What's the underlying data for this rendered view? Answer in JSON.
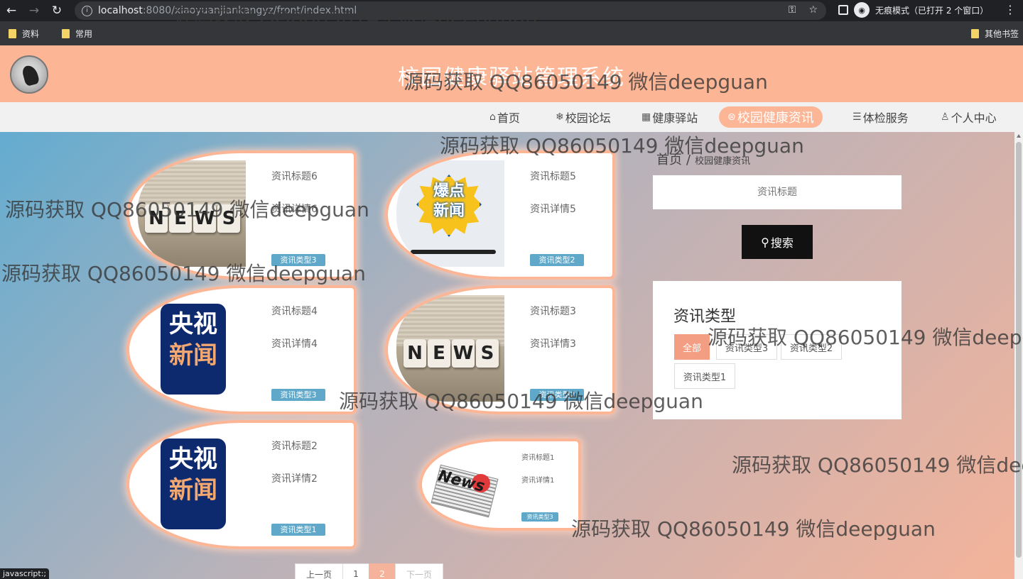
{
  "browser": {
    "url_host": "localhost",
    "url_rest": ":8080/xiaoyuanjiankangyz/front/index.html",
    "incognito_label": "无痕模式（已打开 2 个窗口）",
    "bookmarks": [
      "资料",
      "常用"
    ],
    "other_bookmarks": "其他书签",
    "status_text": "javascript:;"
  },
  "site": {
    "title": "校园健康驿站管理系统"
  },
  "nav": {
    "items": [
      {
        "icon": "⌂",
        "label": "首页"
      },
      {
        "icon": "❄",
        "label": "校园论坛"
      },
      {
        "icon": "▦",
        "label": "健康驿站"
      },
      {
        "icon": "⊜",
        "label": "校园健康资讯"
      },
      {
        "icon": "☰",
        "label": "体检服务"
      },
      {
        "icon": "♙",
        "label": "个人中心"
      }
    ]
  },
  "cards": [
    {
      "title": "资讯标题6",
      "detail": "资讯详情6",
      "type": "资讯类型3"
    },
    {
      "title": "资讯标题5",
      "detail": "资讯详情5",
      "type": "资讯类型2"
    },
    {
      "title": "资讯标题4",
      "detail": "资讯详情4",
      "type": "资讯类型3"
    },
    {
      "title": "资讯标题3",
      "detail": "资讯详情3",
      "type": "资讯类型2"
    },
    {
      "title": "资讯标题2",
      "detail": "资讯详情2",
      "type": "资讯类型1"
    },
    {
      "title": "资讯标题1",
      "detail": "资讯详情1",
      "type": "资讯类型3"
    }
  ],
  "thumb_text": {
    "news_letters": [
      "N",
      "E",
      "W",
      "S"
    ],
    "baodian": "爆点\n新闻",
    "cctv_line1": "央视",
    "cctv_line2": "新闻",
    "newspaper_word": "News"
  },
  "sidebar": {
    "breadcrumb_home": "首页",
    "breadcrumb_sep": "/",
    "breadcrumb_current": "校园健康资讯",
    "search_placeholder": "资讯标题",
    "search_button": "搜索",
    "types_heading": "资讯类型",
    "types": [
      "全部",
      "资讯类型3",
      "资讯类型2",
      "资讯类型1"
    ]
  },
  "pagination": {
    "prev": "上一页",
    "pages": [
      "1",
      "2"
    ],
    "current": "2",
    "next": "下一页"
  },
  "watermark": {
    "text": "源码获取 QQ86050149 微信deepguan"
  },
  "colors": {
    "header": "#fcb595",
    "accent": "#f39d83",
    "tag": "#5fa8c9"
  }
}
